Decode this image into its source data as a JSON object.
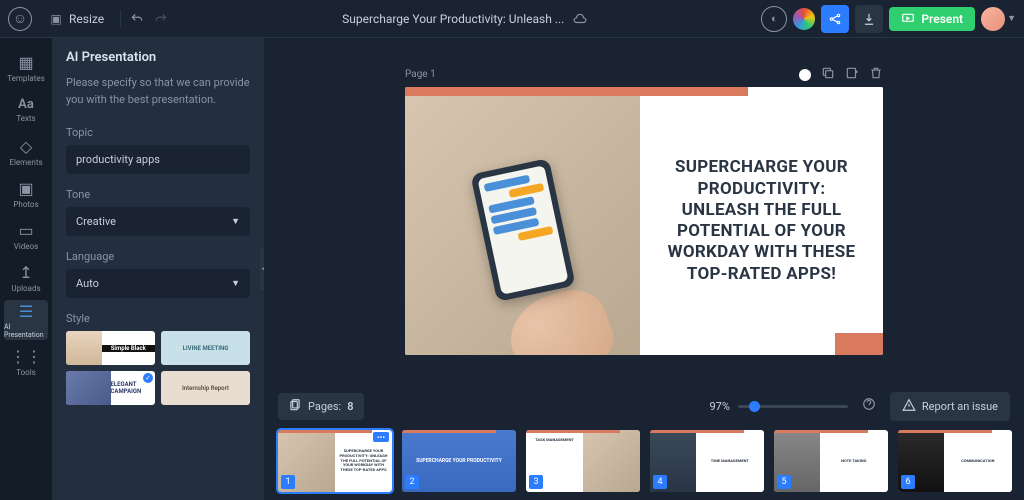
{
  "topbar": {
    "resize_label": "Resize",
    "title": "Supercharge Your Productivity: Unleash ...",
    "present_label": "Present"
  },
  "leftrail": {
    "items": [
      {
        "label": "Templates",
        "icon": "▦"
      },
      {
        "label": "Texts",
        "icon": "Aa"
      },
      {
        "label": "Elements",
        "icon": "◇"
      },
      {
        "label": "Photos",
        "icon": "▣"
      },
      {
        "label": "Videos",
        "icon": "▭"
      },
      {
        "label": "Uploads",
        "icon": "↥"
      },
      {
        "label": "AI Presentation",
        "icon": "☰",
        "active": true
      },
      {
        "label": "Tools",
        "icon": "⋮⋮"
      }
    ]
  },
  "sidepanel": {
    "title": "AI Presentation",
    "instruction": "Please specify so that we can provide you with the best presentation.",
    "topic_label": "Topic",
    "topic_value": "productivity apps",
    "tone_label": "Tone",
    "tone_value": "Creative",
    "language_label": "Language",
    "language_value": "Auto",
    "style_label": "Style",
    "styles": [
      {
        "name": "Simple Black"
      },
      {
        "name": "LIVINE MEETING"
      },
      {
        "name": "ELEGANT CAMPAIGN"
      },
      {
        "name": "Internship Report"
      }
    ]
  },
  "canvas": {
    "page_label": "Page 1",
    "slide_heading": "SUPERCHARGE YOUR PRODUCTIVITY: UNLEASH THE FULL POTENTIAL OF YOUR WORKDAY WITH THESE TOP-RATED APPS!"
  },
  "bottombar": {
    "pages_label": "Pages:",
    "pages_count": "8",
    "zoom_value": "97%",
    "report_label": "Report an issue"
  },
  "thumbs": [
    {
      "num": "1",
      "title": "SUPERCHARGE YOUR PRODUCTIVITY: UNLEASH THE FULL POTENTIAL OF YOUR WORKDAY WITH THESE TOP-RATED APPS",
      "active": true
    },
    {
      "num": "2",
      "title": "SUPERCHARGE YOUR PRODUCTIVITY"
    },
    {
      "num": "3",
      "title": "TASK MANAGEMENT"
    },
    {
      "num": "4",
      "title": "TIME MANAGEMENT"
    },
    {
      "num": "5",
      "title": "NOTE TAKING"
    },
    {
      "num": "6",
      "title": "COMMUNICATION"
    }
  ]
}
